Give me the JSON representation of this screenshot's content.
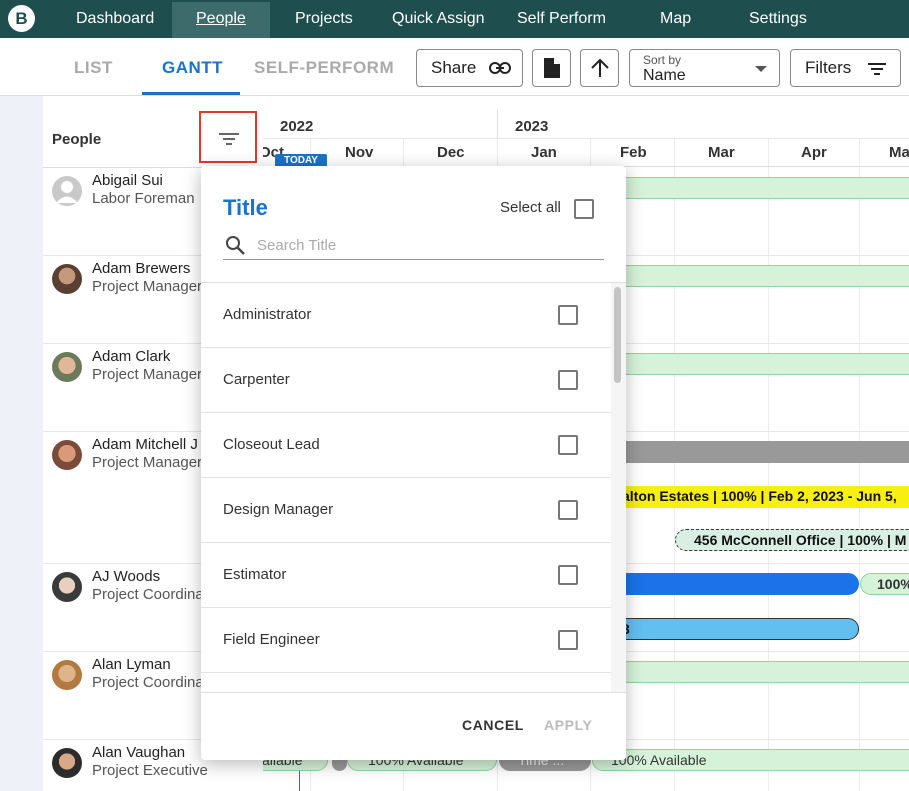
{
  "nav": {
    "logo": "B",
    "items": [
      {
        "label": "Dashboard"
      },
      {
        "label": "People"
      },
      {
        "label": "Projects"
      },
      {
        "label": "Quick Assign"
      },
      {
        "label": "Self Perform"
      },
      {
        "label": "Map"
      },
      {
        "label": "Settings"
      }
    ],
    "active": "People"
  },
  "toolbar": {
    "view_tabs": [
      {
        "label": "LIST"
      },
      {
        "label": "GANTT"
      },
      {
        "label": "SELF-PERFORM"
      }
    ],
    "active_tab": "GANTT",
    "share_label": "Share",
    "sort_caption": "Sort by",
    "sort_value": "Name",
    "filters_label": "Filters"
  },
  "people_header": "People",
  "people": [
    {
      "name": "Abigail Sui",
      "title": "Labor Foreman"
    },
    {
      "name": "Adam Brewers",
      "title": "Project Manager"
    },
    {
      "name": "Adam Clark",
      "title": "Project Manager"
    },
    {
      "name": "Adam Mitchell J",
      "title": "Project Manager"
    },
    {
      "name": "AJ Woods",
      "title": "Project Coordina"
    },
    {
      "name": "Alan Lyman",
      "title": "Project Coordina"
    },
    {
      "name": "Alan Vaughan",
      "title": "Project Executive"
    }
  ],
  "timeline": {
    "years": [
      "2022",
      "2023"
    ],
    "months": [
      "Oct",
      "Nov",
      "Dec",
      "Jan",
      "Feb",
      "Mar",
      "Apr",
      "Ma"
    ],
    "today_label": "TODAY",
    "bars": {
      "yellow": "alton Estates | 100% | Feb 2, 2023 - Jun 5,",
      "dashed": "456 McConnell Office | 100% | M",
      "aj_pct": "100%",
      "aj_light": "3",
      "bottom_1": "ailable",
      "bottom_2": "100% Available",
      "bottom_3": "Time ...",
      "bottom_4": "100% Available"
    }
  },
  "filter_popup": {
    "title": "Title",
    "select_all_label": "Select all",
    "search_placeholder": "Search Title",
    "options": [
      {
        "label": "Administrator"
      },
      {
        "label": "Carpenter"
      },
      {
        "label": "Closeout Lead"
      },
      {
        "label": "Design Manager"
      },
      {
        "label": "Estimator"
      },
      {
        "label": "Field Engineer"
      }
    ],
    "cancel_label": "CANCEL",
    "apply_label": "APPLY"
  },
  "colors": {
    "nav_bg": "#1f4e4e",
    "accent": "#1a73c8",
    "highlight": "#e0392a"
  }
}
